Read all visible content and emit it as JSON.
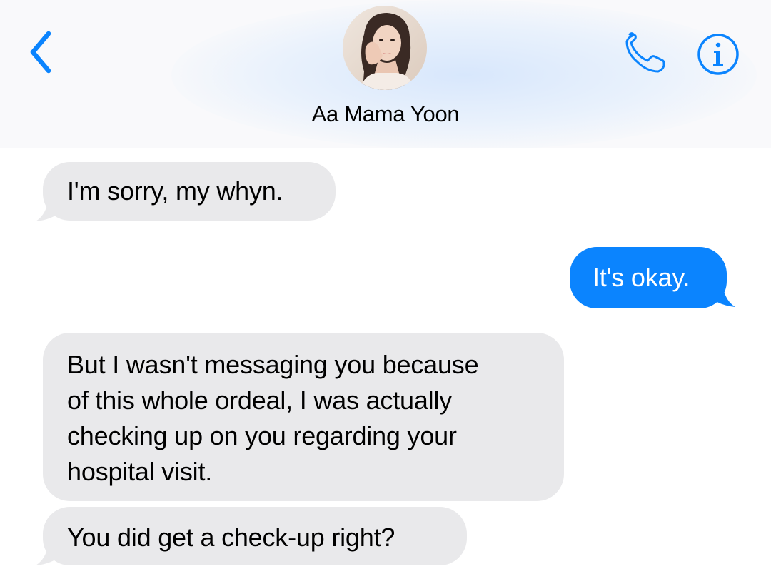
{
  "header": {
    "contact_name": "Aa Mama Yoon",
    "accent_color": "#0b84fe",
    "icons": {
      "back": "chevron-left-icon",
      "phone": "phone-icon",
      "info": "info-icon"
    }
  },
  "messages": [
    {
      "direction": "incoming",
      "text": "I'm sorry, my whyn."
    },
    {
      "direction": "outgoing",
      "text": "It's okay."
    },
    {
      "direction": "incoming",
      "lines": [
        "But I wasn't messaging you because",
        "of this whole ordeal, I was actually",
        "checking up on you regarding your",
        "hospital visit."
      ]
    },
    {
      "direction": "incoming",
      "text": "You did get a check-up right?"
    }
  ],
  "colors": {
    "incoming_bubble": "#e9e9eb",
    "outgoing_bubble": "#0b84fe",
    "header_background": "#f9f9fb"
  }
}
